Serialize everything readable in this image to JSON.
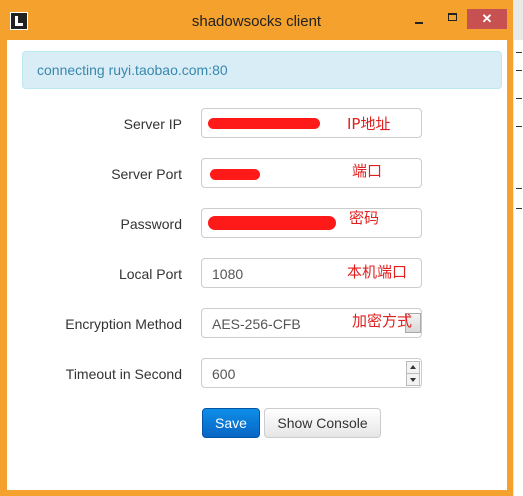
{
  "window": {
    "title": "shadowsocks client",
    "close_glyph": "✕",
    "accent_color": "#f5a12d"
  },
  "status": {
    "message": "connecting ruyi.taobao.com:80"
  },
  "form": {
    "server_ip": {
      "label": "Server IP",
      "value_redacted": true,
      "note": "IP地址"
    },
    "server_port": {
      "label": "Server Port",
      "value_redacted": true,
      "note": "端口"
    },
    "password": {
      "label": "Password",
      "value_redacted": true,
      "note": "密码"
    },
    "local_port": {
      "label": "Local Port",
      "value": "1080",
      "note": "本机端口"
    },
    "encryption": {
      "label": "Encryption Method",
      "value": "AES-256-CFB",
      "note": "加密方式"
    },
    "timeout": {
      "label": "Timeout in Second",
      "value": "600"
    }
  },
  "buttons": {
    "save": "Save",
    "show_console": "Show Console"
  }
}
